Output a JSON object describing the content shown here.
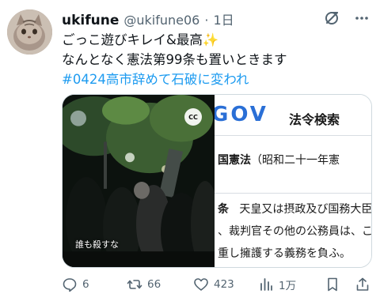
{
  "user": {
    "display_name": "ukifune",
    "handle": "@ukifune06",
    "separator": "·",
    "time": "1日"
  },
  "tweet": {
    "line1": "ごっこ遊びキレイ&最高",
    "line1_emoji": "✨",
    "line2": "なんとなく憲法第99条も置いときます",
    "hashtag": "#0424高市辞めて石破に変われ"
  },
  "video": {
    "cc_label": "CC",
    "caption": "誰も殺すな"
  },
  "document": {
    "logo": "GOV",
    "header_title": "法令検索",
    "law_title_bold": "国憲法",
    "law_title_rest": "（昭和二十一年憲",
    "article_label": "条",
    "line1": "天皇又は摂政及び国務大臣",
    "line2": "、裁判官その他の公務員は、こ",
    "line3": "重し擁護する義務を負ふ。"
  },
  "actions": {
    "replies": "6",
    "reposts": "66",
    "likes": "423",
    "views": "1万"
  },
  "colors": {
    "hashtag": "#1d9bf0",
    "secondary_text": "#536471",
    "gov_blue": "#2a6fd6"
  }
}
